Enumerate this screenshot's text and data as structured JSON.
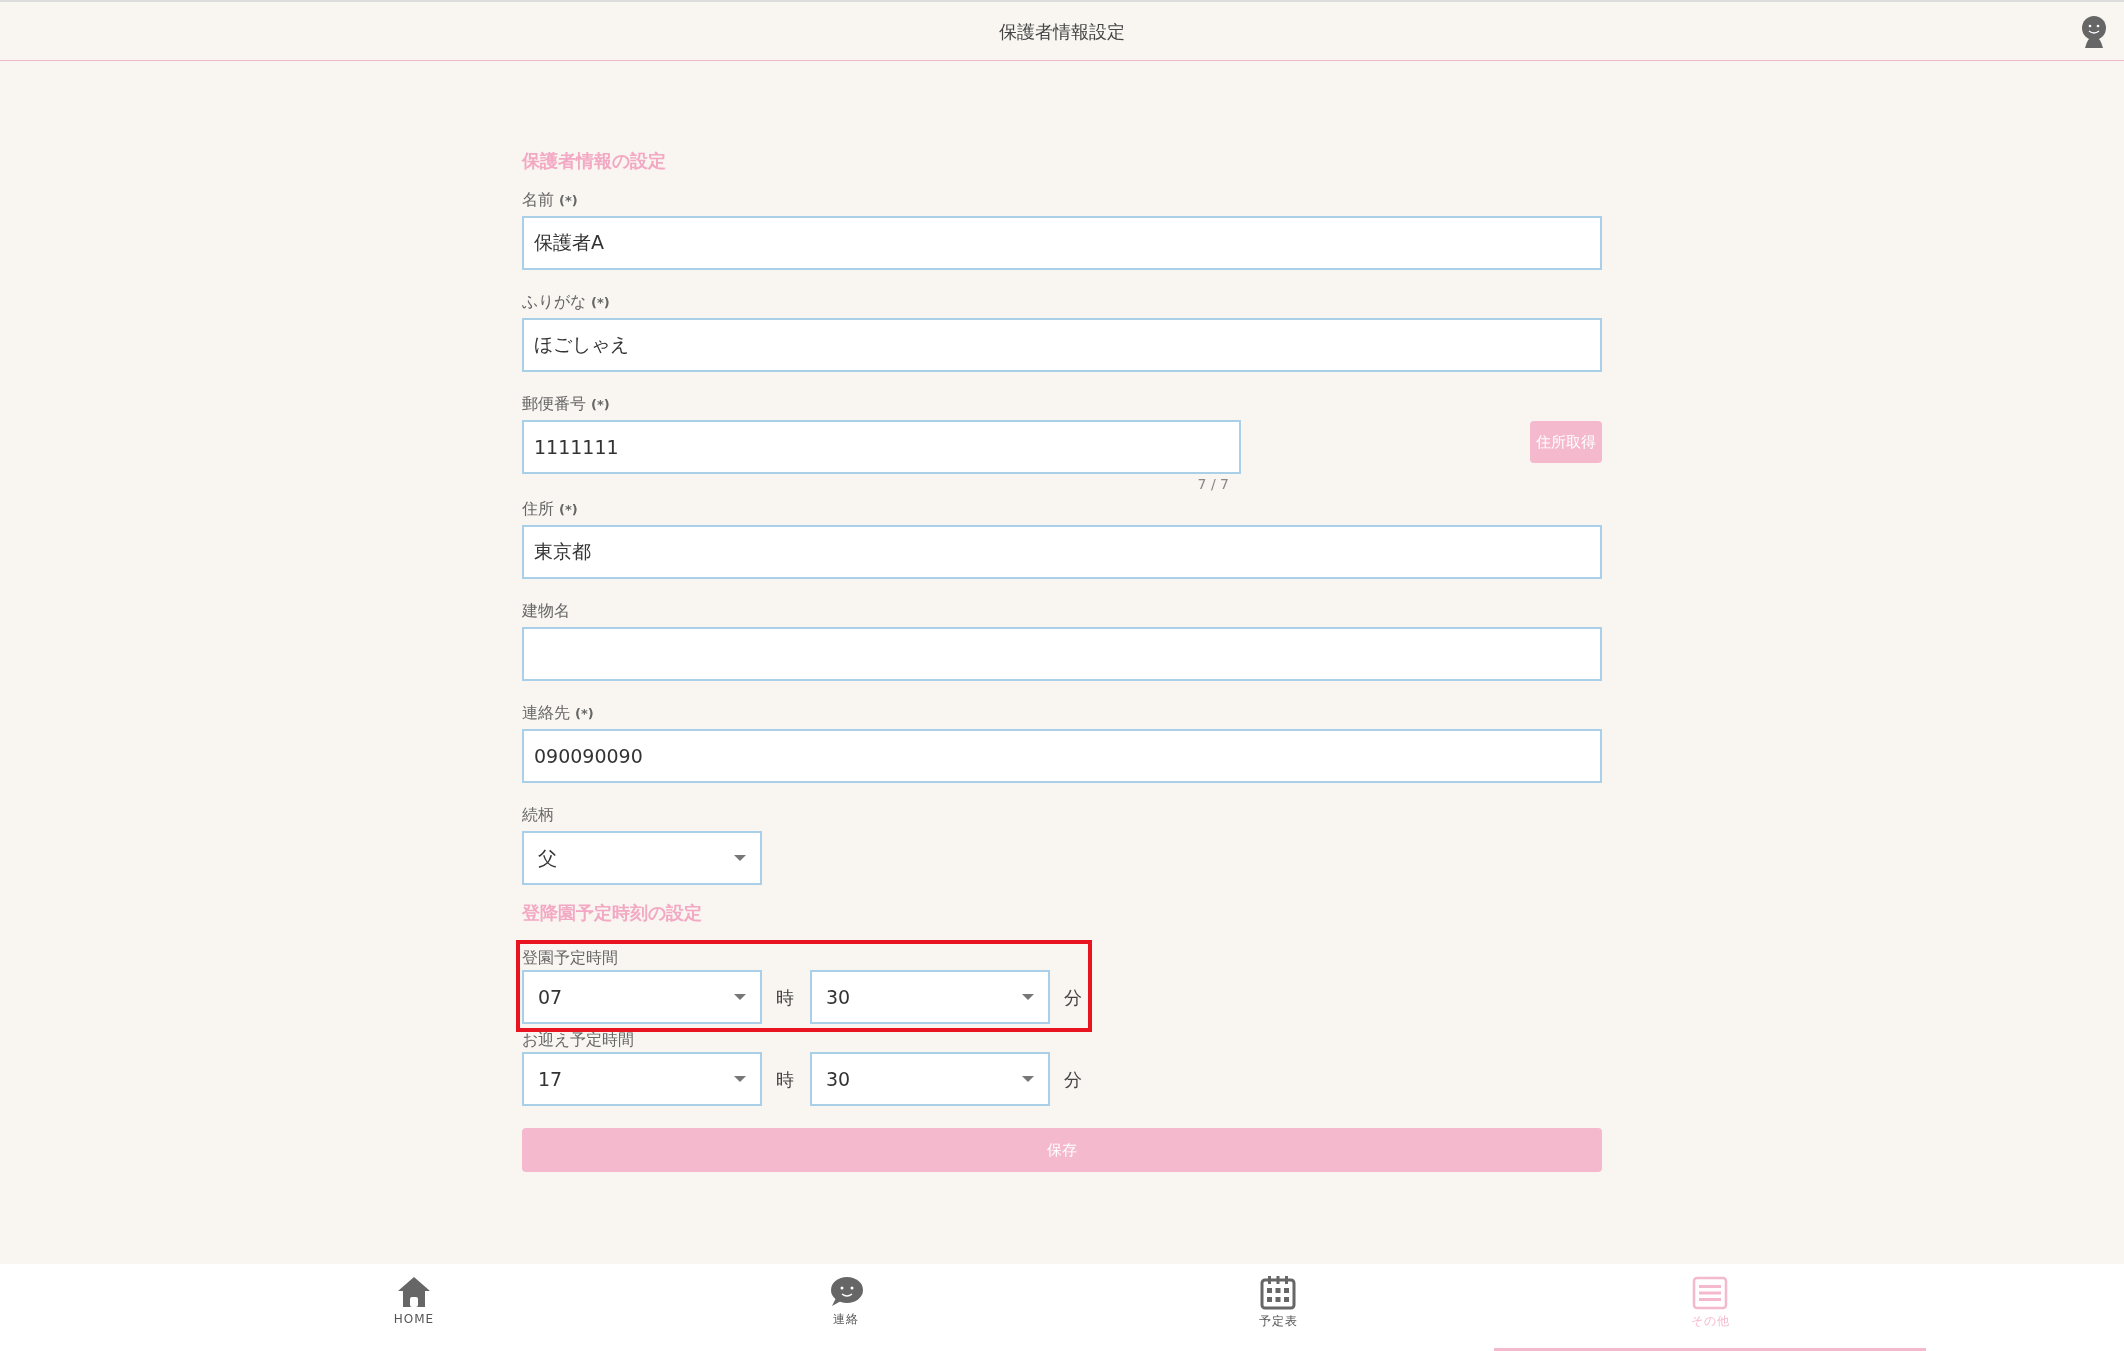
{
  "header": {
    "title": "保護者情報設定"
  },
  "sections": [
    {
      "title": "保護者情報の設定",
      "fields": [
        {
          "kind": "text",
          "label": "名前",
          "required_mark": "(*)",
          "value": "保護者A"
        },
        {
          "kind": "text",
          "label": "ふりがな",
          "required_mark": "(*)",
          "value": "ほごしゃえ"
        },
        {
          "kind": "postal",
          "label": "郵便番号",
          "required_mark": "(*)",
          "value": "1111111",
          "counter": "7 / 7",
          "button": "住所取得"
        },
        {
          "kind": "text",
          "label": "住所",
          "required_mark": "(*)",
          "value": "東京都"
        },
        {
          "kind": "text",
          "label": "建物名"
        },
        {
          "kind": "text",
          "label": "連絡先",
          "required_mark": "(*)",
          "value": "090090090"
        },
        {
          "kind": "select",
          "label": "続柄",
          "value": "父"
        }
      ]
    },
    {
      "title": "登降園予定時刻の設定",
      "fields": [
        {
          "kind": "time",
          "label": "登園予定時間",
          "hour": "07",
          "hour_unit": "時",
          "minute": "30",
          "minute_unit": "分",
          "highlighted": true
        },
        {
          "kind": "time",
          "label": "お迎え予定時間",
          "hour": "17",
          "hour_unit": "時",
          "minute": "30",
          "minute_unit": "分",
          "highlighted": false
        }
      ]
    }
  ],
  "save_button": "保存",
  "bottom_nav": [
    {
      "kind": "home",
      "label": "HOME",
      "selected": false
    },
    {
      "kind": "chat",
      "label": "連絡",
      "selected": false
    },
    {
      "kind": "calendar",
      "label": "予定表",
      "selected": false
    },
    {
      "kind": "menu",
      "label": "その他",
      "selected": true
    }
  ]
}
